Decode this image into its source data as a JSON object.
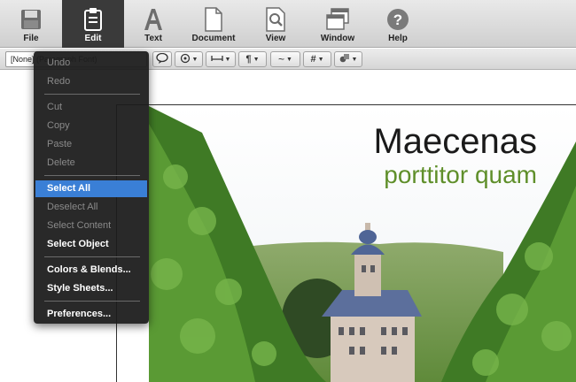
{
  "toolbar": {
    "items": [
      {
        "label": "File",
        "icon": "save-icon"
      },
      {
        "label": "Edit",
        "icon": "clipboard-icon",
        "active": true
      },
      {
        "label": "Text",
        "icon": "text-icon"
      },
      {
        "label": "Document",
        "icon": "document-icon"
      },
      {
        "label": "View",
        "icon": "magnifier-icon"
      },
      {
        "label": "Window",
        "icon": "window-icon"
      },
      {
        "label": "Help",
        "icon": "help-icon"
      }
    ]
  },
  "subbar": {
    "style_select": "[None] (Paragraph Font)"
  },
  "edit_menu": {
    "items": [
      {
        "label": "Undo",
        "state": "disabled"
      },
      {
        "label": "Redo",
        "state": "disabled"
      },
      {
        "label": "Cut",
        "state": "disabled"
      },
      {
        "label": "Copy",
        "state": "disabled"
      },
      {
        "label": "Paste",
        "state": "disabled"
      },
      {
        "label": "Delete",
        "state": "disabled"
      },
      {
        "label": "Select All",
        "state": "selected"
      },
      {
        "label": "Deselect All",
        "state": "disabled"
      },
      {
        "label": "Select Content",
        "state": "disabled"
      },
      {
        "label": "Select Object",
        "state": "enabled"
      },
      {
        "label": "Colors & Blends...",
        "state": "enabled"
      },
      {
        "label": "Style Sheets...",
        "state": "enabled"
      },
      {
        "label": "Preferences...",
        "state": "enabled"
      }
    ]
  },
  "page": {
    "headline": "Maecenas",
    "subhead": "porttitor quam"
  },
  "colors": {
    "accent": "#3a7fd6",
    "subhead_green": "#5f8f2a",
    "menu_bg": "#1c1c1c"
  }
}
